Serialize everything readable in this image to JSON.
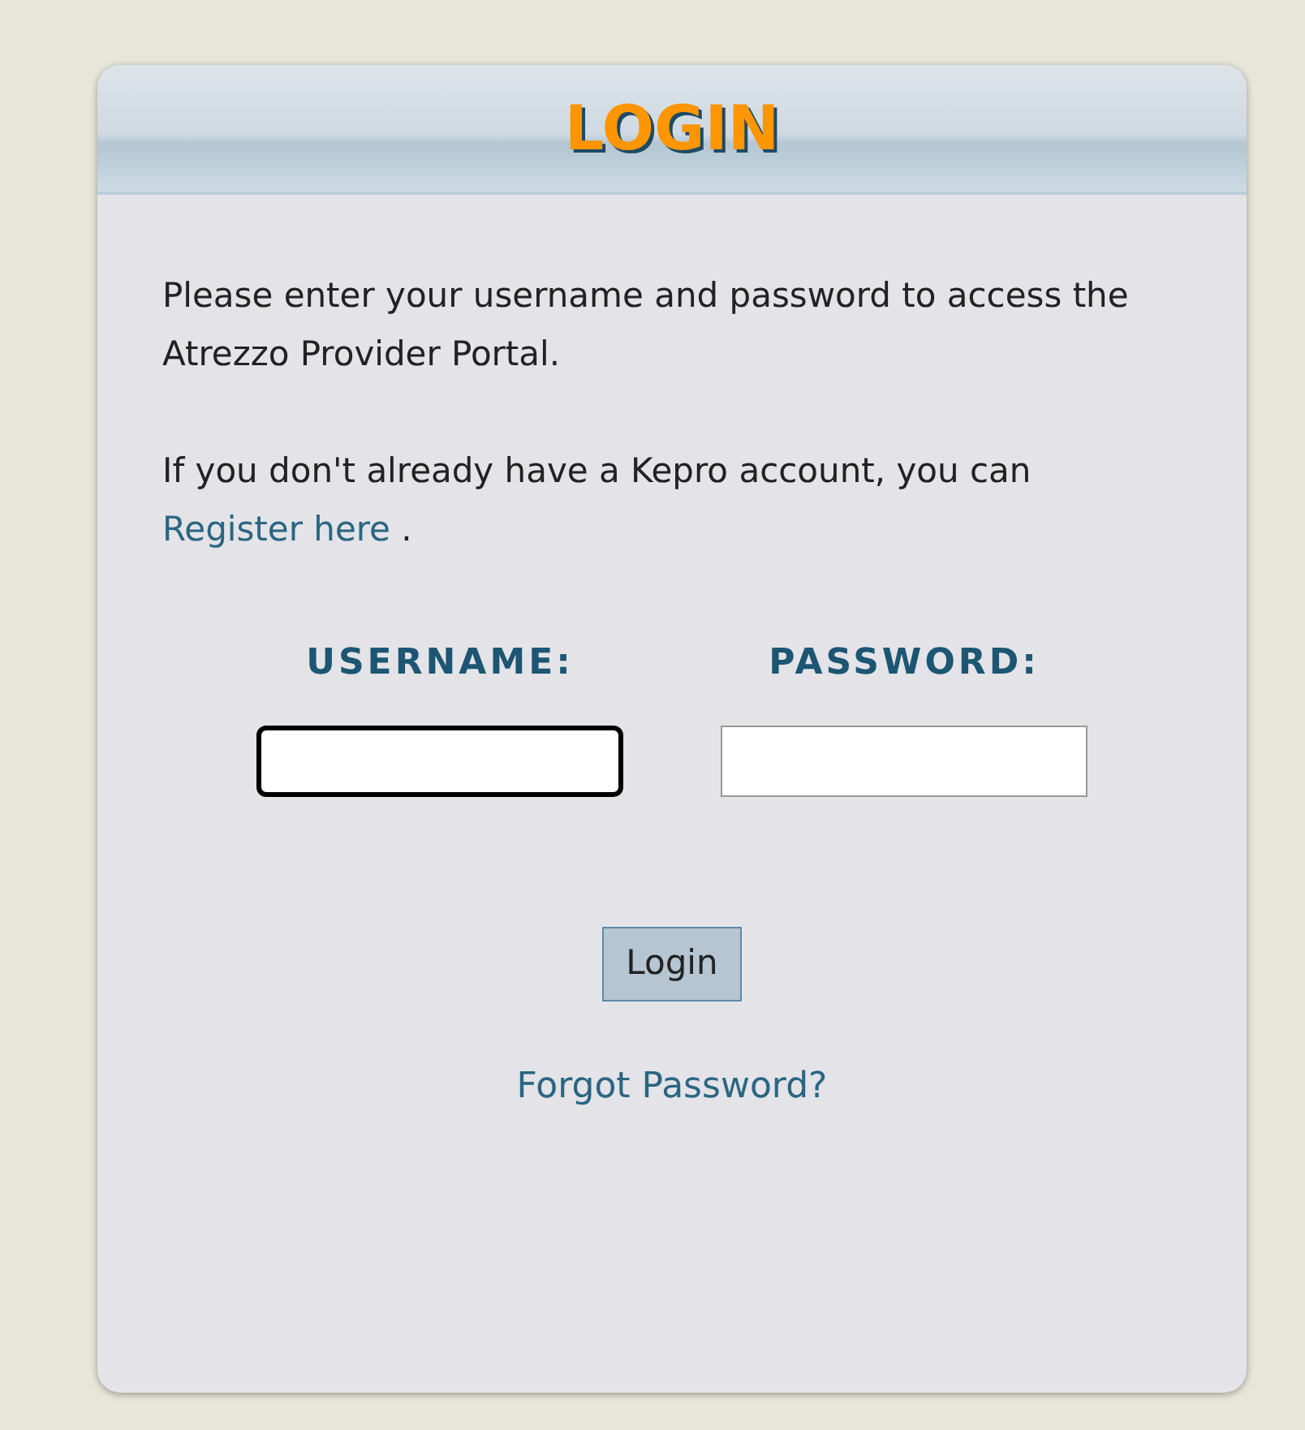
{
  "panel": {
    "title": "LOGIN"
  },
  "intro": "Please enter your username and password to access the Atrezzo Provider Portal.",
  "register_prompt": {
    "text": "If you don't already have a Kepro account, you can",
    "link": "Register here",
    "after": "."
  },
  "fields": [
    {
      "label": "USERNAME:",
      "focused": true
    },
    {
      "label": "PASSWORD:",
      "focused": false
    }
  ],
  "login_button": "Login",
  "forgot_link": "Forgot Password?"
}
